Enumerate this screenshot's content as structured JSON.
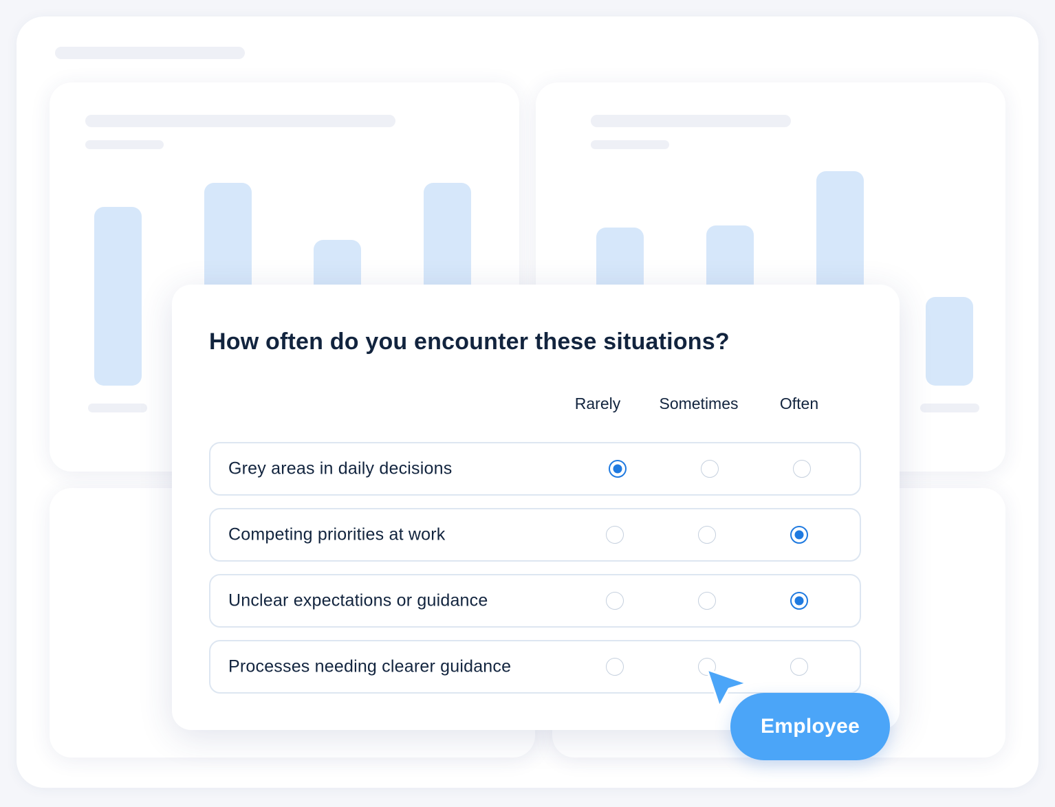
{
  "survey": {
    "question": "How often do you encounter these situations?",
    "columns": [
      "Rarely",
      "Sometimes",
      "Often"
    ],
    "rows": [
      {
        "label": "Grey areas in daily decisions",
        "selected": "Rarely"
      },
      {
        "label": "Competing priorities at work",
        "selected": "Often"
      },
      {
        "label": "Unclear expectations or guidance",
        "selected": "Often"
      },
      {
        "label": "Processes needing clearer guidance",
        "selected": null
      }
    ]
  },
  "badge": {
    "label": "Employee"
  },
  "cursor": {
    "icon": "arrow-pointer-icon",
    "color": "#4ba5f8"
  },
  "colors": {
    "accent": "#1f7ae0",
    "bar": "#d6e7fa",
    "badge": "#4ba5f8",
    "text": "#12243e"
  }
}
